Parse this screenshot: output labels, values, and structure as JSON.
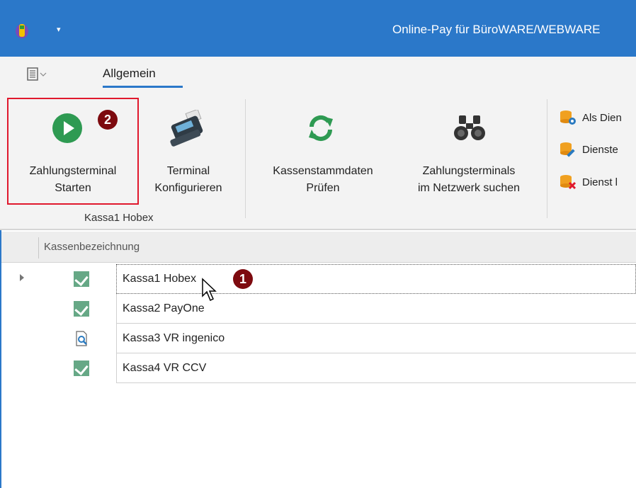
{
  "window": {
    "title": "Online-Pay für BüroWARE/WEBWARE",
    "quick_access_arrow": "▾"
  },
  "ribbon": {
    "tabs": [
      {
        "label": "Allgemein",
        "active": true
      }
    ],
    "groups": [
      {
        "label": "Kassa1 Hobex",
        "buttons": [
          {
            "label_line1": "Zahlungsterminal",
            "label_line2": "Starten",
            "icon": "play-icon"
          },
          {
            "label_line1": "Terminal",
            "label_line2": "Konfigurieren",
            "icon": "card-terminal-icon"
          }
        ]
      },
      {
        "label": "",
        "buttons": [
          {
            "label_line1": "Kassenstammdaten",
            "label_line2": "Prüfen",
            "icon": "refresh-icon"
          },
          {
            "label_line1": "Zahlungsterminals",
            "label_line2": "im Netzwerk suchen",
            "icon": "binoculars-icon"
          }
        ]
      },
      {
        "label": "",
        "small_buttons": [
          {
            "label": "Als Dien",
            "icon": "database-gear-icon"
          },
          {
            "label": "Dienste",
            "icon": "database-edit-icon"
          },
          {
            "label": "Dienst l",
            "icon": "database-delete-icon"
          }
        ]
      }
    ]
  },
  "annotations": {
    "badge_1": "1",
    "badge_2": "2"
  },
  "grid": {
    "column_header": "Kassenbezeichnung",
    "rows": [
      {
        "name": "Kassa1 Hobex",
        "status": "check-icon",
        "selected": true
      },
      {
        "name": "Kassa2 PayOne",
        "status": "check-icon",
        "selected": false
      },
      {
        "name": "Kassa3 VR ingenico",
        "status": "document-search-icon",
        "selected": false
      },
      {
        "name": "Kassa4 VR CCV",
        "status": "check-icon",
        "selected": false
      }
    ]
  },
  "colors": {
    "title_bar": "#2b78c9",
    "ribbon_bg": "#f3f3f3",
    "highlight": "#e0182d",
    "badge": "#7d0a0f",
    "play_green": "#2e9a52",
    "status_green": "#66a886"
  }
}
